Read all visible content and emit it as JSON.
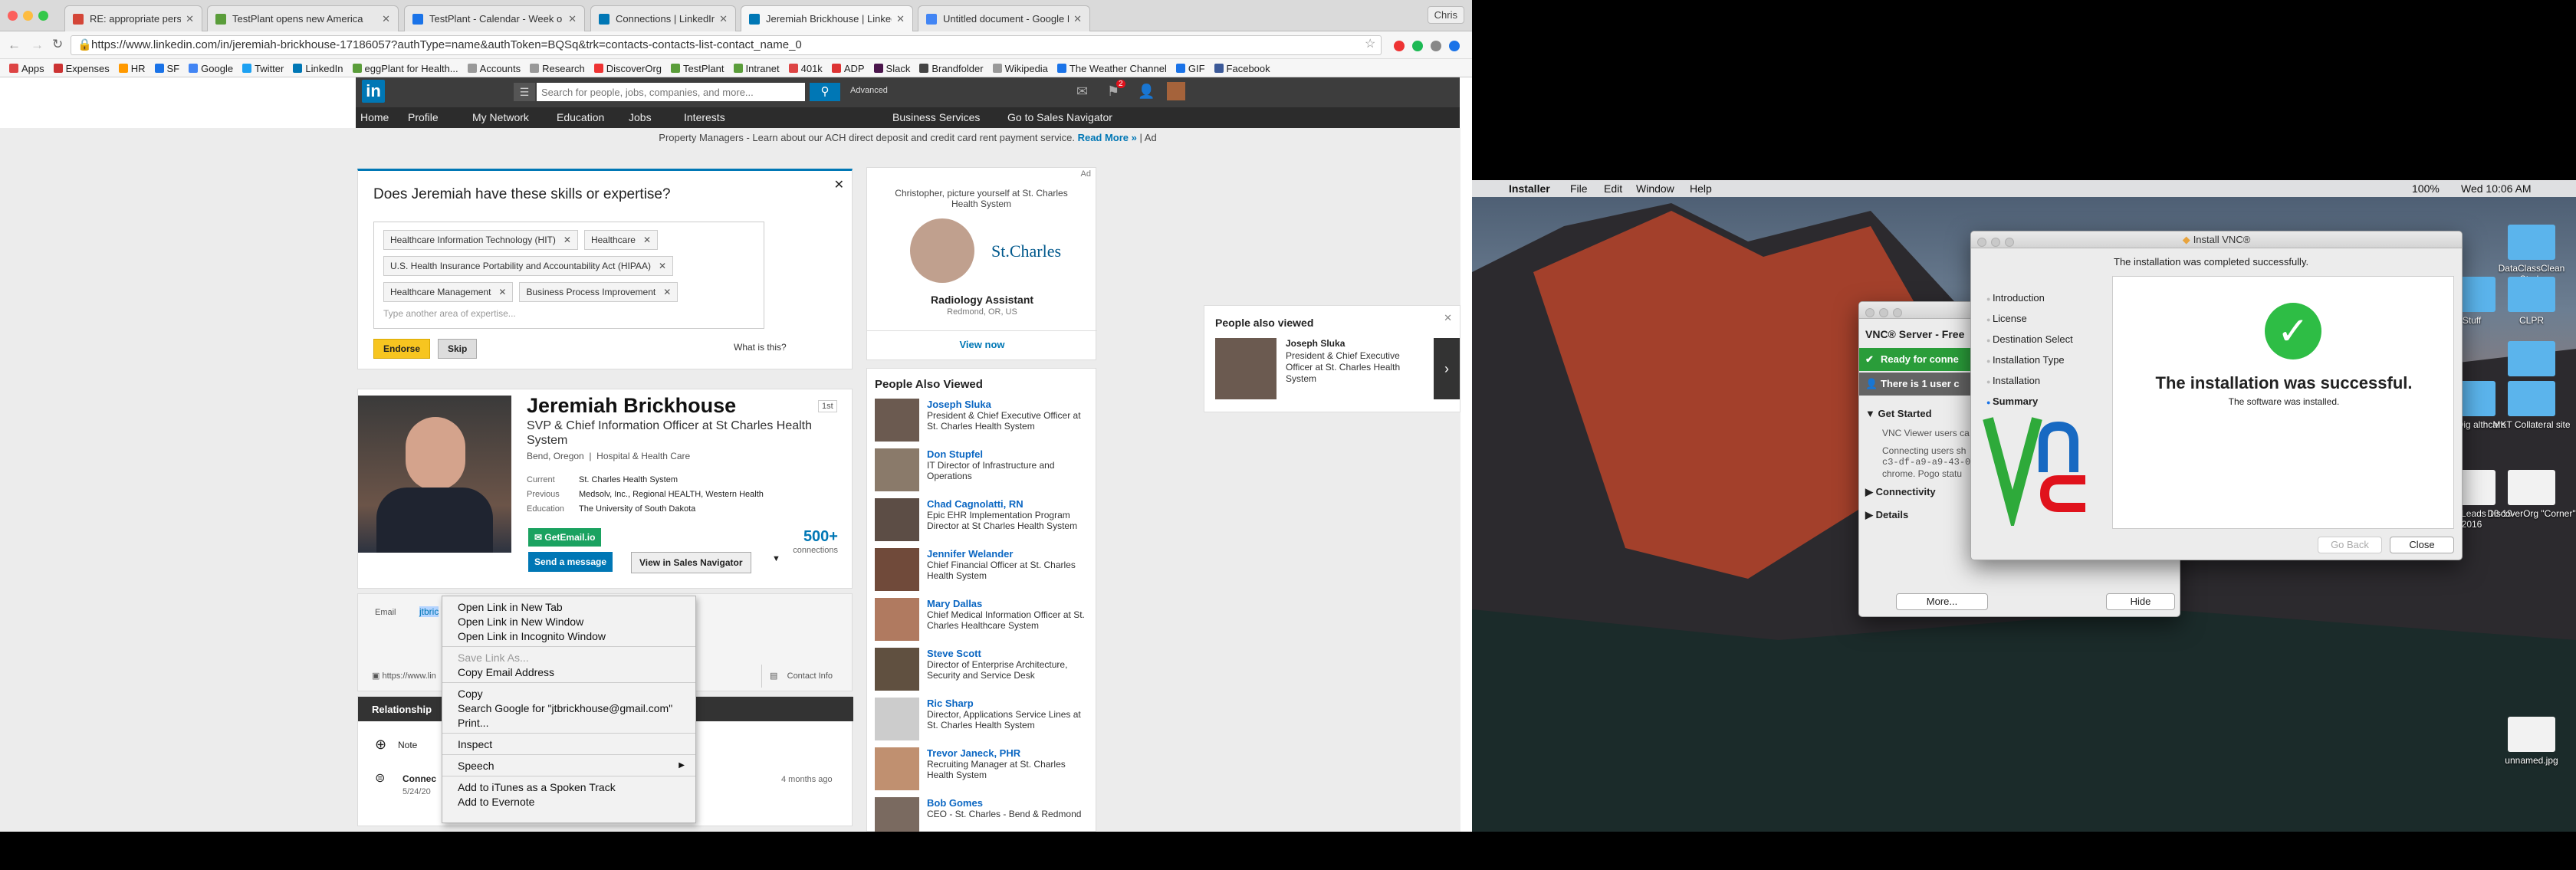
{
  "chrome": {
    "tabs": [
      {
        "label": "RE: appropriate person - chris",
        "icon": "gmail-icon",
        "color": "#d44638"
      },
      {
        "label": "TestPlant opens new America",
        "icon": "testplant-icon",
        "color": "#5a9d3a"
      },
      {
        "label": "TestPlant - Calendar - Week o",
        "icon": "calendar-icon",
        "color": "#1a73e8"
      },
      {
        "label": "Connections | LinkedIn",
        "icon": "linkedin-icon",
        "color": "#0077b5"
      },
      {
        "label": "Jeremiah Brickhouse | LinkedIn",
        "icon": "linkedin-icon",
        "color": "#0077b5"
      },
      {
        "label": "Untitled document - Google Do",
        "icon": "docs-icon",
        "color": "#4285f4"
      }
    ],
    "user_button": "Chris",
    "url": "https://www.linkedin.com/in/jeremiah-brickhouse-17186057?authType=name&authToken=BQSq&trk=contacts-contacts-list-contact_name_0",
    "bookmarks": [
      "Apps",
      "Expenses",
      "HR",
      "SF",
      "Google",
      "Twitter",
      "LinkedIn",
      "eggPlant for Health...",
      "Accounts",
      "Research",
      "DiscoverOrg",
      "TestPlant",
      "Intranet",
      "401k",
      "ADP",
      "Slack",
      "Brandfolder",
      "Wikipedia",
      "The Weather Channel",
      "GIF",
      "Facebook"
    ]
  },
  "linkedin": {
    "logo": "in",
    "search_placeholder": "Search for people, jobs, companies, and more...",
    "advanced": "Advanced",
    "notif_count": "2",
    "nav": [
      "Home",
      "Profile",
      "My Network",
      "Education",
      "Jobs",
      "Interests"
    ],
    "nav_right": [
      "Business Services",
      "Go to Sales Navigator"
    ],
    "ad_text": "Property Managers - Learn about our ACH direct deposit and credit card rent payment service.",
    "ad_link": "Read More »",
    "ad_tag": "| Ad",
    "skills": {
      "question": "Does Jeremiah have these skills or expertise?",
      "chips": [
        "Healthcare Information Technology (HIT)",
        "Healthcare",
        "U.S. Health Insurance Portability and Accountability Act (HIPAA)",
        "Healthcare Management",
        "Business Process Improvement"
      ],
      "input_placeholder": "Type another area of expertise...",
      "endorse": "Endorse",
      "skip": "Skip",
      "what": "What is this?"
    },
    "profile": {
      "name": "Jeremiah Brickhouse",
      "degree": "1st",
      "headline": "SVP & Chief Information Officer at St Charles Health System",
      "location": "Bend, Oregon",
      "industry": "Hospital & Health Care",
      "current_label": "Current",
      "current": "St. Charles Health System",
      "previous_label": "Previous",
      "previous": "Medsolv, Inc., Regional HEALTH, Western Health",
      "education_label": "Education",
      "education": "The University of South Dakota",
      "getemail": "GetEmail.io",
      "send": "Send a message",
      "sales_nav": "View in Sales Navigator",
      "connections": "500+",
      "connections_label": "connections",
      "email_label": "Email",
      "email_partial": "jtbric",
      "website_partial": "https://www.lin",
      "contact_info": "Contact Info"
    },
    "relationship": {
      "tab": "Relationship",
      "note": "Note",
      "connected": "Connec",
      "date": "5/24/20",
      "ago": "4 months ago"
    },
    "sidead": {
      "ad": "Ad",
      "text": "Christopher, picture yourself at St. Charles Health System",
      "org": "St.Charles",
      "job": "Radiology Assistant",
      "loc": "Redmond, OR, US",
      "cta": "View now"
    },
    "pav_title": "People Also Viewed",
    "pav": [
      {
        "name": "Joseph Sluka",
        "title": "President & Chief Executive Officer at St. Charles Health System"
      },
      {
        "name": "Don Stupfel",
        "title": "IT Director of Infrastructure and Operations"
      },
      {
        "name": "Chad Cagnolatti, RN",
        "title": "Epic EHR Implementation Program Director at St Charles Health System"
      },
      {
        "name": "Jennifer Welander",
        "title": "Chief Financial Officer at St. Charles Health System"
      },
      {
        "name": "Mary Dallas",
        "title": "Chief Medical Information Officer at St. Charles Healthcare System"
      },
      {
        "name": "Steve Scott",
        "title": "Director of Enterprise Architecture, Security and Service Desk"
      },
      {
        "name": "Ric Sharp",
        "title": "Director, Applications Service Lines at St. Charles Health System"
      },
      {
        "name": "Trevor Janeck, PHR",
        "title": "Recruiting Manager at St. Charles Health System"
      },
      {
        "name": "Bob Gomes",
        "title": "CEO - St. Charles - Bend & Redmond"
      }
    ],
    "popup": {
      "title": "People also viewed",
      "name": "Joseph Sluka",
      "desc": "President & Chief Executive Officer at St. Charles Health System"
    }
  },
  "context_menu": {
    "items": [
      "Open Link in New Tab",
      "Open Link in New Window",
      "Open Link in Incognito Window",
      "Save Link As...",
      "Copy Email Address",
      "Copy",
      "Search Google for \"jtbrickhouse@gmail.com\"",
      "Print...",
      "Inspect",
      "Speech",
      "Add to iTunes as a Spoken Track",
      "Add to Evernote"
    ]
  },
  "mac": {
    "menubar": [
      "Installer",
      "File",
      "Edit",
      "Window",
      "Help"
    ],
    "battery": "100%",
    "clock": "Wed 10:06 AM",
    "desktop_icons": [
      "DataClassClean Study",
      "Stuff",
      "CLPR",
      "Sales Stuff",
      "acts Dig althcare",
      "MKT Collateral site",
      "CCL All Leads 10-19-2016",
      "DiscoverOrg \"Corner\"",
      "unnamed.jpg"
    ],
    "vnc_server": {
      "title": "VNC® Server - Free",
      "ready": "Ready for conne",
      "users": "There is 1 user c",
      "get_started": "Get Started",
      "body1": "VNC Viewer users ca",
      "body2": "Connecting users sh",
      "body3": "c3-df-a9-a9-43-0",
      "body4": "chrome. Pogo statu",
      "connectivity": "Connectivity",
      "details": "Details",
      "more": "More...",
      "hide": "Hide"
    },
    "installer": {
      "title": "Install VNC®",
      "header": "The installation was completed successfully.",
      "steps": [
        "Introduction",
        "License",
        "Destination Select",
        "Installation Type",
        "Installation",
        "Summary"
      ],
      "success": "The installation was successful.",
      "sub": "The software was installed.",
      "go_back": "Go Back",
      "close": "Close"
    }
  }
}
